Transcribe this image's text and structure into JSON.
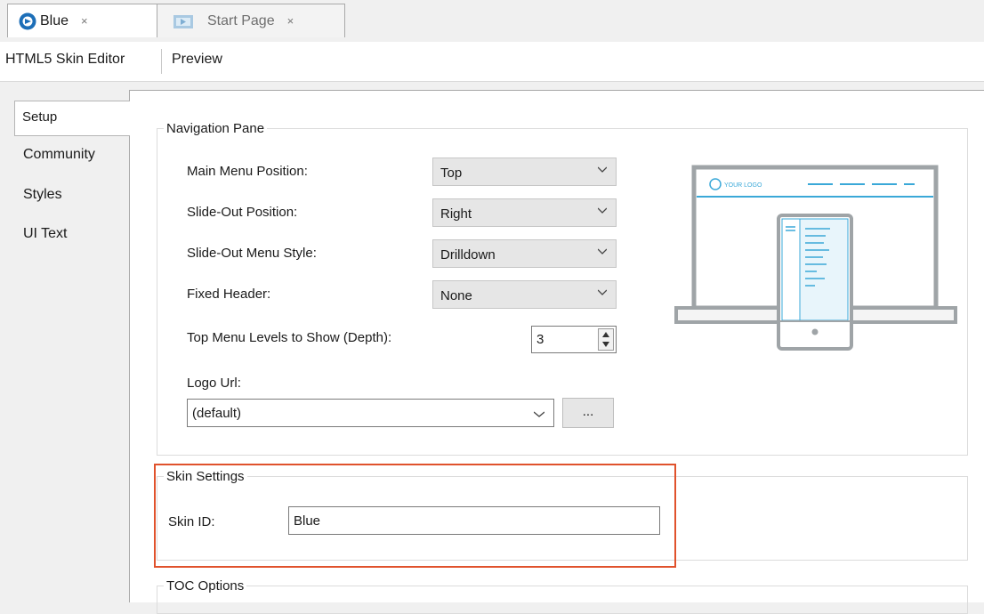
{
  "tabs": [
    {
      "label": "Blue",
      "close": "×",
      "active": true,
      "icon": "app-logo-icon"
    },
    {
      "label": "Start Page",
      "close": "×",
      "active": false,
      "icon": "start-page-icon"
    }
  ],
  "menu": [
    "HTML5 Skin Editor",
    "Preview"
  ],
  "side_tabs": [
    "Setup",
    "Community",
    "Styles",
    "UI Text"
  ],
  "navigation_pane": {
    "legend": "Navigation Pane",
    "main_menu_position": {
      "label": "Main Menu Position:",
      "value": "Top"
    },
    "slide_out_position": {
      "label": "Slide-Out Position:",
      "value": "Right"
    },
    "slide_out_menu_style": {
      "label": "Slide-Out Menu Style:",
      "value": "Drilldown"
    },
    "fixed_header": {
      "label": "Fixed Header:",
      "value": "None"
    },
    "top_menu_levels": {
      "label": "Top Menu Levels to Show (Depth):",
      "value": "3"
    },
    "logo_url": {
      "label": "Logo Url:",
      "value": "(default)",
      "browse_label": "..."
    },
    "preview_logo_text": "YOUR LOGO"
  },
  "skin_settings": {
    "legend": "Skin Settings",
    "skin_id_label": "Skin ID:",
    "skin_id_value": "Blue"
  },
  "toc_options": {
    "legend": "TOC Options"
  },
  "colors": {
    "accent": "#e0522c",
    "illustration": "#9fa4a7",
    "illustration_blue": "#3aa8d8"
  }
}
